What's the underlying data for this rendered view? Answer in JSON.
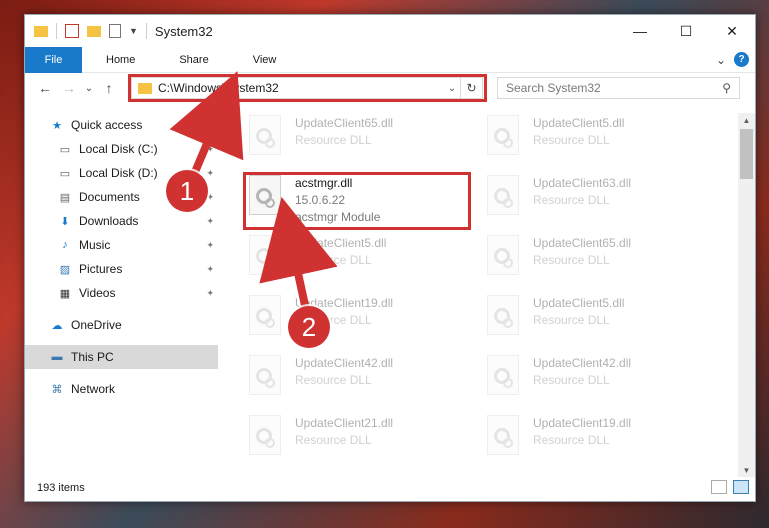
{
  "window": {
    "title": "System32",
    "controls": {
      "minimize": "—",
      "maximize": "☐",
      "close": "✕"
    }
  },
  "ribbon": {
    "tabs": [
      "File",
      "Home",
      "Share",
      "View"
    ],
    "expand": "⌄",
    "help": "?"
  },
  "nav": {
    "back": "←",
    "forward": "→",
    "recent": "⌄",
    "up": "↑",
    "address": "C:\\Windows\\System32",
    "address_dropdown": "⌄",
    "refresh": "↻",
    "search_placeholder": "Search System32",
    "search_icon": "⚲"
  },
  "sidebar": {
    "items": [
      {
        "label": "Quick access",
        "icon": "★",
        "pinned": false,
        "indent": 0
      },
      {
        "label": "Local Disk (C:)",
        "icon": "▭",
        "pinned": true,
        "indent": 1
      },
      {
        "label": "Local Disk (D:)",
        "icon": "▭",
        "pinned": true,
        "indent": 1
      },
      {
        "label": "Documents",
        "icon": "▤",
        "pinned": true,
        "indent": 1
      },
      {
        "label": "Downloads",
        "icon": "⬇",
        "pinned": true,
        "indent": 1
      },
      {
        "label": "Music",
        "icon": "♪",
        "pinned": true,
        "indent": 1
      },
      {
        "label": "Pictures",
        "icon": "▨",
        "pinned": true,
        "indent": 1
      },
      {
        "label": "Videos",
        "icon": "▦",
        "pinned": true,
        "indent": 1
      },
      {
        "label": "OneDrive",
        "icon": "☁",
        "pinned": false,
        "indent": 0
      },
      {
        "label": "This PC",
        "icon": "▬",
        "pinned": false,
        "indent": 0,
        "selected": true
      },
      {
        "label": "Network",
        "icon": "⌘",
        "pinned": false,
        "indent": 0
      }
    ],
    "pin_glyph": "📌"
  },
  "files": {
    "left": [
      {
        "name": "UpdateClient65.dll",
        "sub": "Resource DLL",
        "faded": true
      },
      {
        "name": "acstmgr.dll",
        "sub": "15.0.6.22",
        "sub2": "acstmgr Module",
        "faded": false
      },
      {
        "name": "UpdateClient5.dll",
        "sub": "Resource DLL",
        "faded": true
      },
      {
        "name": "UpdateClient19.dll",
        "sub": "Resource DLL",
        "faded": true
      },
      {
        "name": "UpdateClient42.dll",
        "sub": "Resource DLL",
        "faded": true
      },
      {
        "name": "UpdateClient21.dll",
        "sub": "Resource DLL",
        "faded": true
      }
    ],
    "right": [
      {
        "name": "UpdateClient5.dll",
        "sub": "Resource DLL",
        "faded": true
      },
      {
        "name": "UpdateClient63.dll",
        "sub": "Resource DLL",
        "faded": true
      },
      {
        "name": "UpdateClient65.dll",
        "sub": "Resource DLL",
        "faded": true
      },
      {
        "name": "UpdateClient5.dll",
        "sub": "Resource DLL",
        "faded": true
      },
      {
        "name": "UpdateClient42.dll",
        "sub": "Resource DLL",
        "faded": true
      },
      {
        "name": "UpdateClient19.dll",
        "sub": "Resource DLL",
        "faded": true
      }
    ]
  },
  "status": {
    "count": "193 items"
  },
  "annotations": {
    "marker1": "1",
    "marker2": "2",
    "highlight_color": "#d03232"
  },
  "colors": {
    "accent": "#1979ca",
    "folder": "#f5c342"
  }
}
